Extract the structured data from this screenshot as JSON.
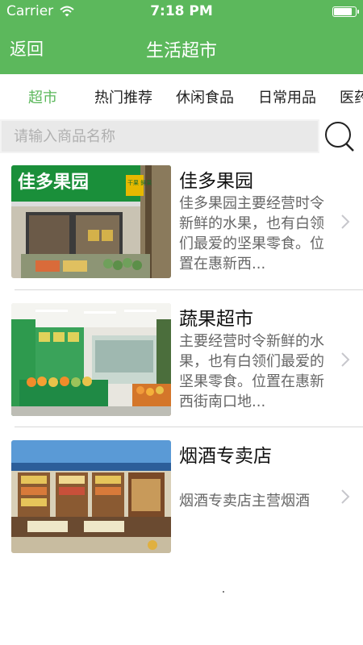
{
  "status": {
    "carrier": "Carrier",
    "time": "7:18 PM",
    "battery_level": 0.9
  },
  "nav": {
    "back_label": "返回",
    "title": "生活超市"
  },
  "tabs": [
    {
      "label": "超市",
      "active": true
    },
    {
      "label": "热门推荐",
      "active": false
    },
    {
      "label": "休闲食品",
      "active": false
    },
    {
      "label": "日常用品",
      "active": false
    },
    {
      "label": "医药",
      "active": false
    }
  ],
  "search": {
    "placeholder": "请输入商品名称",
    "value": ""
  },
  "stores": [
    {
      "name": "佳多果园",
      "description": "佳多果园主要经营时令新鲜的水果，也有白领们最爱的坚果零食。位置在惠新西...",
      "sign_text": "佳多果园",
      "sign_sub": "干果 鲜果"
    },
    {
      "name": "蔬果超市",
      "description": "主要经营时令新鲜的水果，也有白领们最爱的坚果零食。位置在惠新西街南口地..."
    },
    {
      "name": "烟酒专卖店",
      "description": "烟酒专卖店主营烟酒"
    }
  ],
  "colors": {
    "brand_green": "#5cb85c",
    "active_tab": "#5cb85c"
  },
  "icons": {
    "search": "search-icon",
    "chevron": "chevron-right-icon",
    "wifi": "wifi-icon",
    "battery": "battery-icon"
  }
}
